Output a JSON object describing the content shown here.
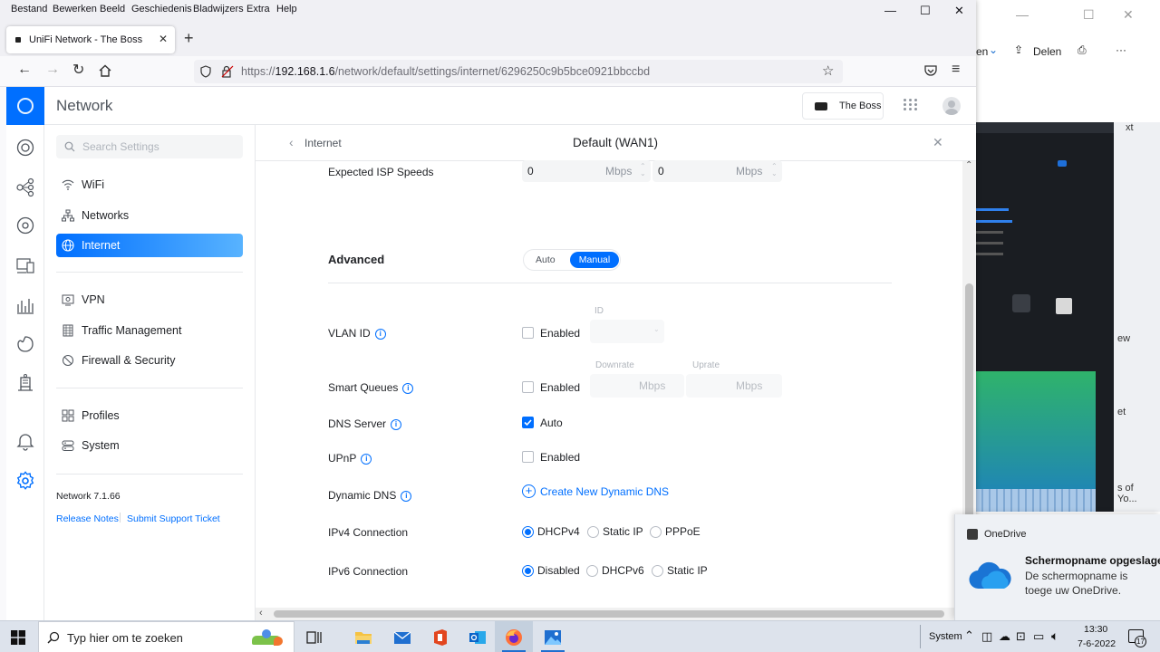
{
  "browser": {
    "menu": [
      "Bestand",
      "Bewerken",
      "Beeld",
      "Geschiedenis",
      "Bladwijzers",
      "Extra",
      "Help"
    ],
    "tab_title": "UniFi Network - The Boss",
    "url_prefix": "https://",
    "url_host": "192.168.1.6",
    "url_path": "/network/default/settings/internet/6296250c9b5bce0921bbccbd"
  },
  "app": {
    "title": "Network",
    "console_name": "The Boss",
    "search_placeholder": "Search Settings",
    "nav": [
      {
        "label": "WiFi",
        "icon": "wifi-icon"
      },
      {
        "label": "Networks",
        "icon": "networks-icon"
      },
      {
        "label": "Internet",
        "icon": "globe-icon",
        "active": true
      },
      {
        "label": "VPN",
        "icon": "vpn-icon"
      },
      {
        "label": "Traffic Management",
        "icon": "traffic-icon"
      },
      {
        "label": "Firewall & Security",
        "icon": "shield-icon"
      },
      {
        "label": "Profiles",
        "icon": "profiles-icon"
      },
      {
        "label": "System",
        "icon": "system-icon"
      }
    ],
    "version": "Network 7.1.66",
    "release_notes": "Release Notes",
    "support": "Submit Support Ticket"
  },
  "panel": {
    "back_label": "Internet",
    "title": "Default (WAN1)",
    "isp_label": "Expected ISP Speeds",
    "isp_down_value": "0",
    "isp_up_value": "0",
    "unit": "Mbps",
    "advanced_label": "Advanced",
    "mode_auto": "Auto",
    "mode_manual": "Manual",
    "vlan_label": "VLAN ID",
    "vlan_enabled": "Enabled",
    "vlan_id_label": "ID",
    "smart_queues_label": "Smart Queues",
    "smart_queues_enabled": "Enabled",
    "downrate_label": "Downrate",
    "uprate_label": "Uprate",
    "dns_label": "DNS Server",
    "dns_auto": "Auto",
    "upnp_label": "UPnP",
    "upnp_enabled": "Enabled",
    "ddns_label": "Dynamic DNS",
    "ddns_create": "Create New Dynamic DNS",
    "ipv4_label": "IPv4 Connection",
    "ipv4_options": [
      "DHCPv4",
      "Static IP",
      "PPPoE"
    ],
    "ipv6_label": "IPv6 Connection",
    "ipv6_options": [
      "Disabled",
      "DHCPv6",
      "Static IP"
    ]
  },
  "bgwindow": {
    "toolbar_partial": "en",
    "share": "Delen",
    "edge_text_1": "xt",
    "edge_text_2": "ew",
    "edge_text_3": "et",
    "edge_text_4": "s of",
    "edge_text_5": "Yo..."
  },
  "toast": {
    "app": "OneDrive",
    "title": "Schermopname opgeslage",
    "body": "De schermopname is toege uw OneDrive."
  },
  "taskbar": {
    "search_placeholder": "Typ hier om te zoeken",
    "system_label": "System",
    "time": "13:30",
    "date": "7-6-2022",
    "notifications": "17"
  },
  "colors": {
    "accent": "#006fff",
    "taskbar": "#dde3ec"
  }
}
